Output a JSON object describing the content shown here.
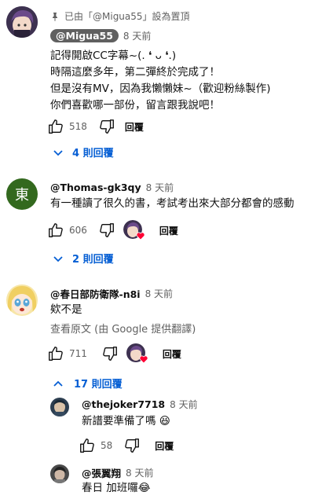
{
  "comments": [
    {
      "pinned_label": "已由「@Migua55」設為置頂",
      "author": "@Migua55",
      "time": "8 天前",
      "text": "記得開啟CC字幕~(. ❛ ᴗ ❛.)\n時隔這麼多年，第二彈終於完成了！\n但是沒有MV，因為我懶懶妹~（歡迎粉絲製作)\n你們喜歡哪一部份，留言跟我說吧！",
      "likes": "518",
      "reply_label": "回覆",
      "replies_link": "4 則回覆"
    },
    {
      "avatar_letter": "東",
      "avatar_color": "#33691e",
      "author": "@Thomas-gk3qy",
      "time": "8 天前",
      "text": "有一種讀了很久的書，考試考出來大部分都會的感動",
      "likes": "606",
      "reply_label": "回覆",
      "replies_link": "2 則回覆"
    },
    {
      "author": "@春日部防衛隊-n8i",
      "time": "8 天前",
      "text": "欸不是",
      "translate_label": "查看原文 (由 Google 提供翻譯)",
      "likes": "711",
      "reply_label": "回覆",
      "replies_link": "17 則回覆",
      "replies": [
        {
          "author": "@thejoker7718",
          "time": "8 天前",
          "text": "新譜要準備了嗎 😆",
          "likes": "58",
          "reply_label": "回覆"
        },
        {
          "author": "@張翼翔",
          "time": "8 天前",
          "text": "春日 加班囉😂"
        }
      ]
    }
  ],
  "colors": {
    "link_blue": "#065fd4",
    "owner_chip": "#606060"
  },
  "icons": [
    "pin-icon",
    "thumb-up-icon",
    "thumb-down-icon",
    "chevron-down-icon",
    "chevron-up-icon",
    "creator-heart-icon"
  ]
}
